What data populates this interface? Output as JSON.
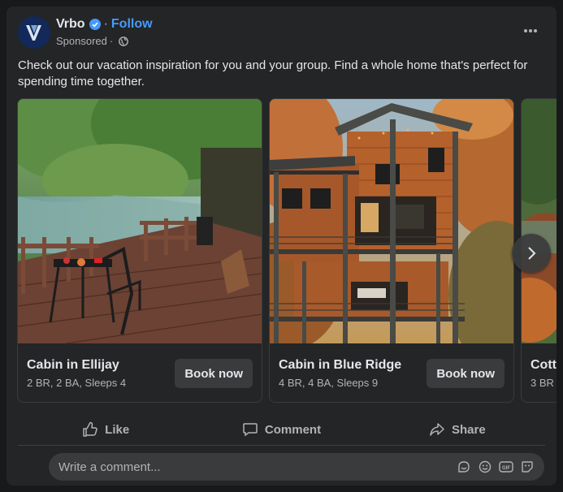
{
  "post": {
    "page_name": "Vrbo",
    "follow_label": "Follow",
    "sponsored_label": "Sponsored",
    "text": "Check out our vacation inspiration for you and your group. Find a whole home that's perfect for spending time together.",
    "accent_color": "#4599ff"
  },
  "carousel": {
    "items": [
      {
        "title": "Cabin in Ellijay",
        "meta": "2 BR, 2 BA, Sleeps 4",
        "cta": "Book now"
      },
      {
        "title": "Cabin in Blue Ridge",
        "meta": "4 BR, 4 BA, Sleeps 9",
        "cta": "Book now"
      },
      {
        "title": "Cott",
        "meta": "3 BR"
      }
    ]
  },
  "actions": {
    "like": "Like",
    "comment": "Comment",
    "share": "Share"
  },
  "comment": {
    "placeholder": "Write a comment..."
  },
  "icons": [
    "verified-badge-icon",
    "globe-icon",
    "more-options-icon",
    "chevron-right-icon",
    "thumbs-up-icon",
    "comment-bubble-icon",
    "share-arrow-icon",
    "sticker-icon",
    "emoji-icon",
    "gif-icon",
    "avatar-sticker-icon"
  ]
}
